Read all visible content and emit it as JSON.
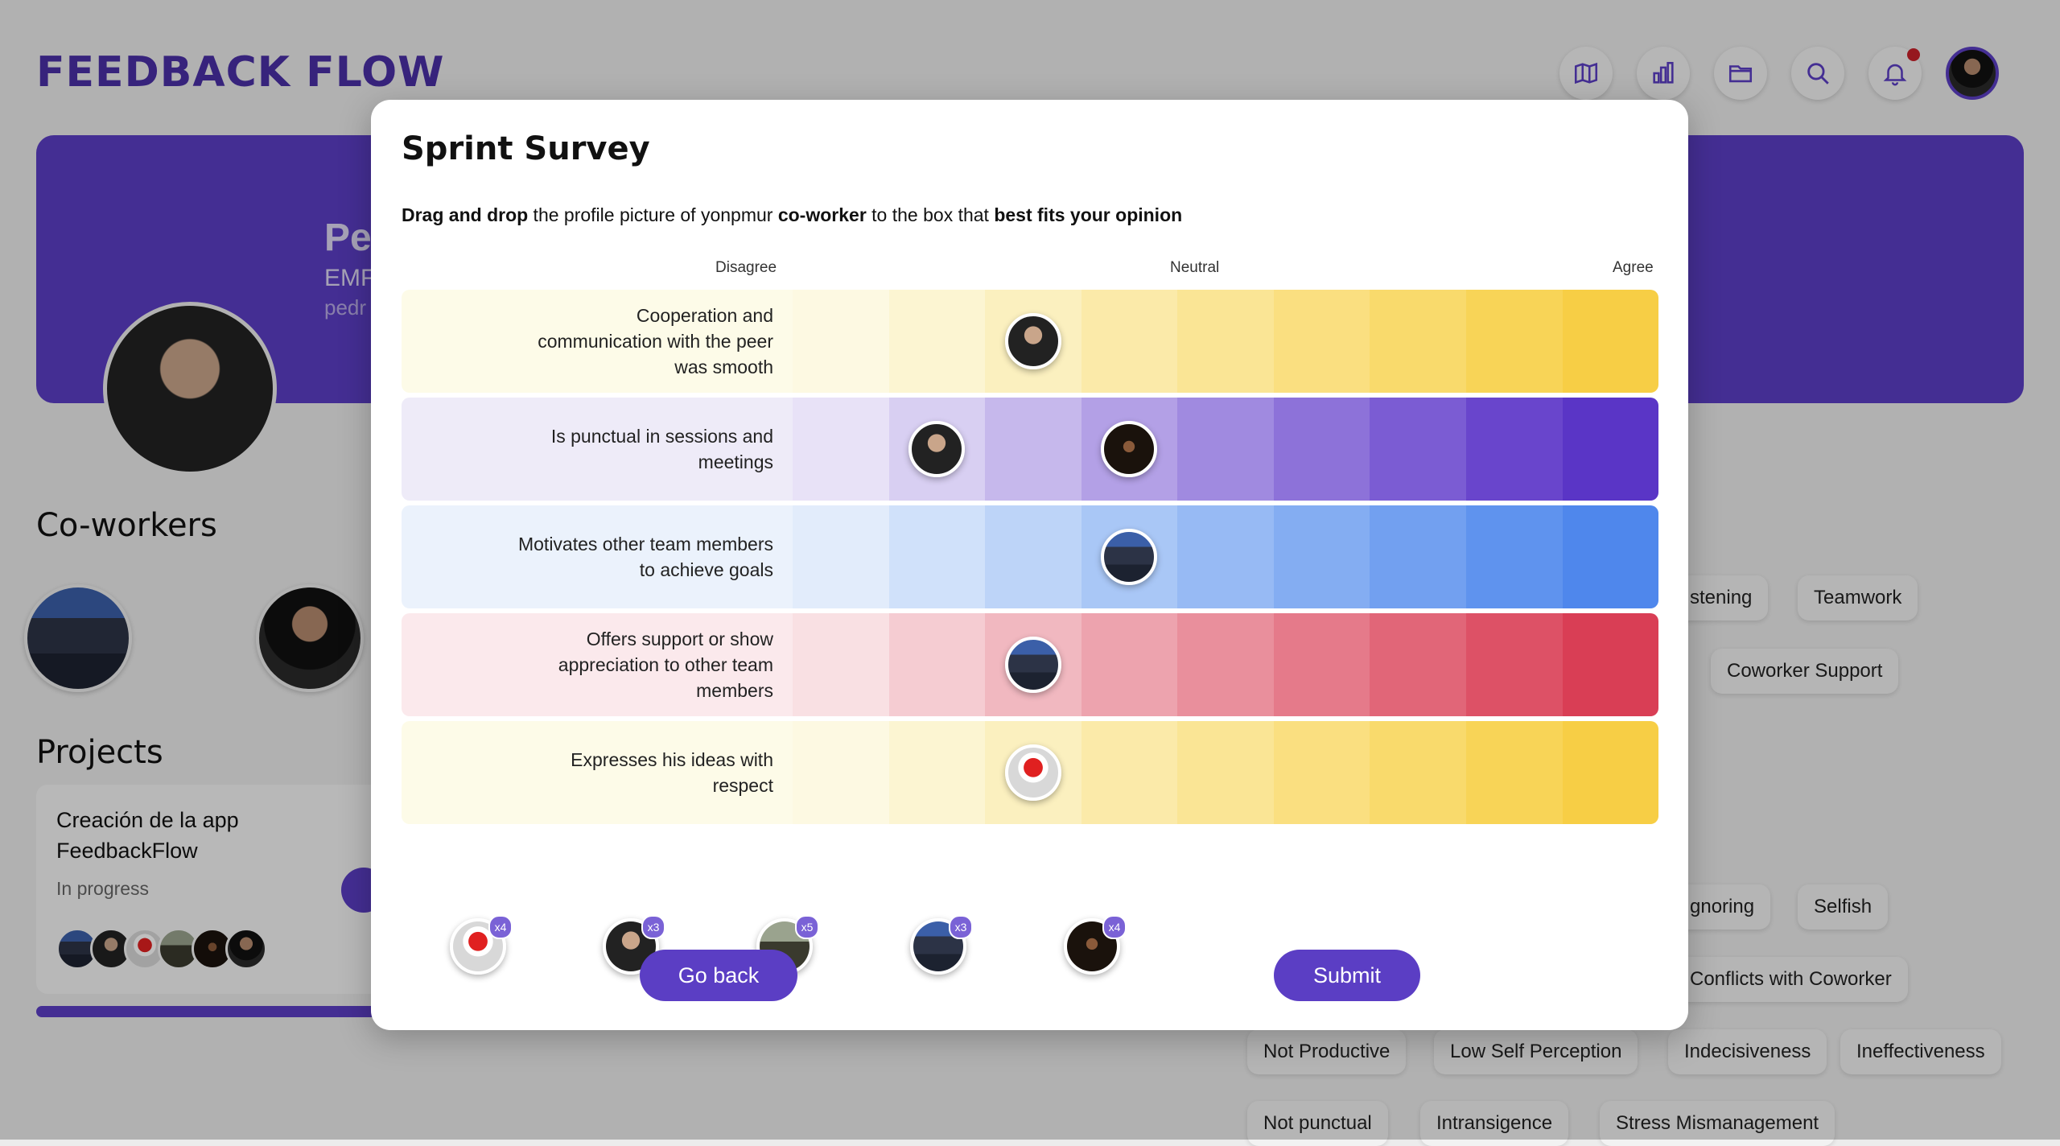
{
  "colors": {
    "brand": "#4a2fa6",
    "accent": "#5b3ec4",
    "notification_dot": "#c8202a",
    "yellow": [
      "#fdf9e2",
      "#fcf5d2",
      "#fbf0bf",
      "#fbeaa9",
      "#fae595",
      "#fadf80",
      "#f9da6c",
      "#f8d457",
      "#f7ce45"
    ],
    "purple": [
      "#e8e2f7",
      "#d8cff2",
      "#c6b8ec",
      "#b3a0e6",
      "#a08ae0",
      "#8d72d9",
      "#7b5cd3",
      "#6945cc",
      "#5a35c6"
    ],
    "blue": [
      "#e2ecfb",
      "#d0e1fa",
      "#bdd4f8",
      "#a9c7f6",
      "#97baf4",
      "#84adf2",
      "#72a0f0",
      "#5f93ee",
      "#4f87ec"
    ],
    "red": [
      "#f9e0e3",
      "#f5ccd2",
      "#f1b8c0",
      "#eda3ae",
      "#e98f9c",
      "#e57a8a",
      "#e16678",
      "#dd5166",
      "#d93e55"
    ],
    "question_bg": {
      "yellow": "#fdfbe8",
      "purple": "#eeebf8",
      "blue": "#ebf2fc",
      "red": "#fbe9ec"
    }
  },
  "app": {
    "brand": "FEEDBACK FLOW",
    "top_icons": [
      "map-icon",
      "bar-chart-icon",
      "folder-icon",
      "search-icon",
      "bell-icon"
    ],
    "profile": {
      "name": "Pe",
      "role": "EMF",
      "email": "pedr"
    },
    "coworkers_title": "Co-workers",
    "projects_title": "Projects",
    "project": {
      "title": "Creación de la app FeedbackFlow",
      "status": "In progress"
    },
    "chips": [
      {
        "label": "stening"
      },
      {
        "label": "Teamwork"
      },
      {
        "label": "Coworker Support"
      },
      {
        "label": "gnoring"
      },
      {
        "label": "Selfish"
      },
      {
        "label": "Conflicts with Coworker"
      },
      {
        "label": "Not Productive"
      },
      {
        "label": "Low Self Perception"
      },
      {
        "label": "Indecisiveness"
      },
      {
        "label": "Ineffectiveness"
      },
      {
        "label": "Not punctual"
      },
      {
        "label": "Intransigence"
      },
      {
        "label": "Stress Mismanagement"
      }
    ]
  },
  "survey": {
    "title": "Sprint Survey",
    "instruction": {
      "part1": "Drag and drop",
      "part2": " the profile picture of yonpmur ",
      "part3": "co-worker",
      "part4": " to the box that ",
      "part5": "best fits your opinion"
    },
    "scale": {
      "left": "Disagree",
      "middle": "Neutral",
      "right": "Agree"
    },
    "questions": [
      {
        "text": "Cooperation and communication with the peer was smooth",
        "palette": "yellow",
        "placed": [
          {
            "col": 2,
            "avatar": "av-suit"
          }
        ]
      },
      {
        "text": "Is punctual in sessions and meetings",
        "palette": "purple",
        "placed": [
          {
            "col": 1,
            "avatar": "av-suit"
          },
          {
            "col": 3,
            "avatar": "av-dark"
          }
        ]
      },
      {
        "text": "Motivates other team members to achieve goals",
        "palette": "blue",
        "placed": [
          {
            "col": 3,
            "avatar": "av-group"
          }
        ]
      },
      {
        "text": "Offers support or show appreciation to other team members",
        "palette": "red",
        "placed": [
          {
            "col": 2,
            "avatar": "av-group"
          }
        ]
      },
      {
        "text": "Expresses his ideas with respect",
        "palette": "yellow",
        "placed": [
          {
            "col": 2,
            "avatar": "av-ranger"
          }
        ]
      }
    ],
    "pool": [
      {
        "avatar": "av-ranger",
        "count": "x4"
      },
      {
        "avatar": "av-suit",
        "count": "x3"
      },
      {
        "avatar": "av-hiker",
        "count": "x5"
      },
      {
        "avatar": "av-group",
        "count": "x3"
      },
      {
        "avatar": "av-dark",
        "count": "x4"
      }
    ],
    "buttons": {
      "back": "Go back",
      "submit": "Submit"
    }
  }
}
